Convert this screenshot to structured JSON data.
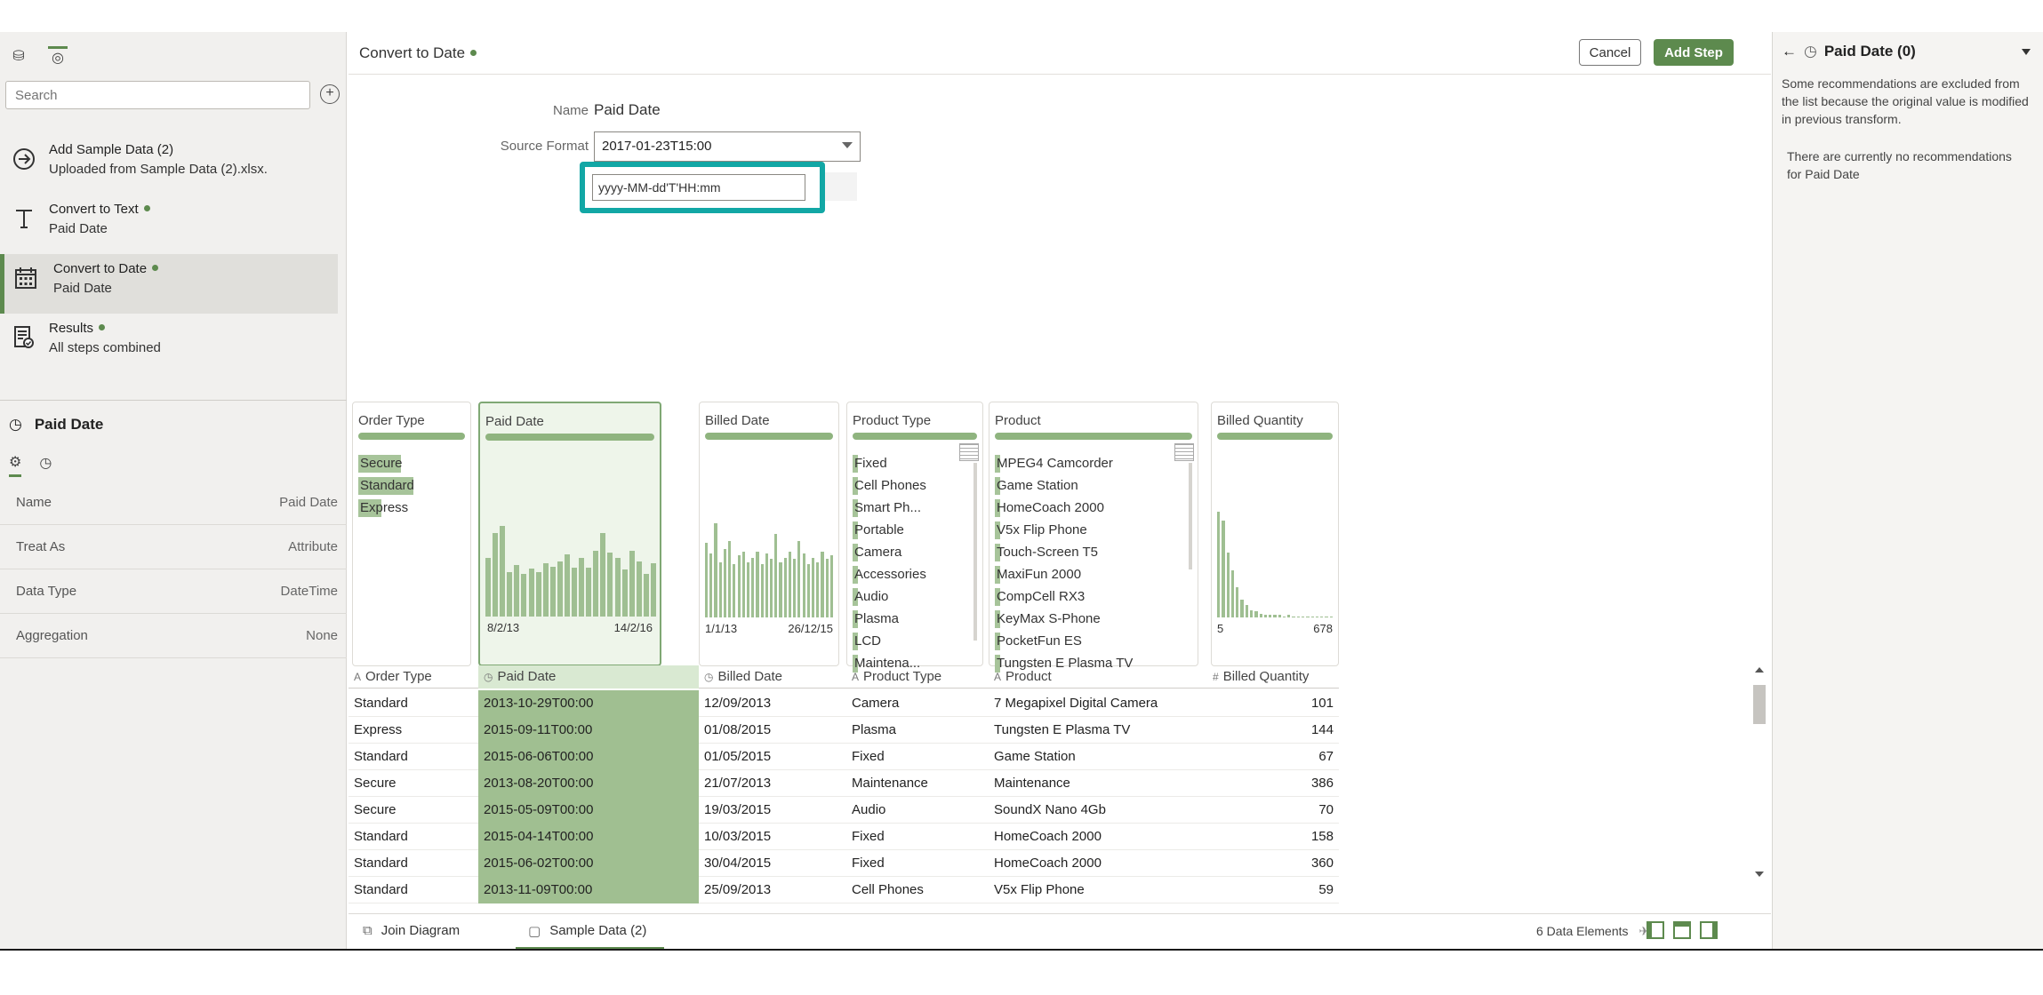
{
  "left": {
    "search_placeholder": "Search",
    "steps": [
      {
        "title": "Add Sample Data (2)",
        "subtitle": "Uploaded from Sample Data (2).xlsx.",
        "icon": "arrow-circle-icon"
      },
      {
        "title": "Convert to Text",
        "subtitle": "Paid Date",
        "icon": "text-t-icon"
      },
      {
        "title": "Convert to Date",
        "subtitle": "Paid Date",
        "icon": "calendar-icon"
      },
      {
        "title": "Results",
        "subtitle": "All steps combined",
        "icon": "results-icon"
      }
    ],
    "props": {
      "title": "Paid Date",
      "rows": [
        {
          "label": "Name",
          "value": "Paid Date"
        },
        {
          "label": "Treat As",
          "value": "Attribute"
        },
        {
          "label": "Data Type",
          "value": "DateTime"
        },
        {
          "label": "Aggregation",
          "value": "None"
        }
      ]
    }
  },
  "center": {
    "title": "Convert to Date",
    "cancel_label": "Cancel",
    "add_step_label": "Add Step",
    "name_label": "Name",
    "name_value": "Paid Date",
    "source_format_label": "Source Format",
    "source_format_value": "2017-01-23T15:00",
    "format_input_value": "yyyy-MM-dd'T'HH:mm"
  },
  "cards": {
    "order_type": {
      "title": "Order Type",
      "items": [
        {
          "label": "Secure",
          "fill": 0.39
        },
        {
          "label": "Standard",
          "fill": 0.51
        },
        {
          "label": "Express",
          "fill": 0.21
        }
      ]
    },
    "paid_date": {
      "title": "Paid Date",
      "axis_min": "8/2/13",
      "axis_max": "14/2/16",
      "bars": [
        0.55,
        0.78,
        0.85,
        0.42,
        0.48,
        0.4,
        0.45,
        0.42,
        0.5,
        0.47,
        0.52,
        0.58,
        0.46,
        0.55,
        0.46,
        0.62,
        0.78,
        0.6,
        0.55,
        0.44,
        0.62,
        0.52,
        0.4,
        0.5
      ]
    },
    "billed_date": {
      "title": "Billed Date",
      "axis_min": "1/1/13",
      "axis_max": "26/12/15",
      "bars": [
        0.7,
        0.6,
        0.88,
        0.52,
        0.64,
        0.72,
        0.5,
        0.58,
        0.62,
        0.52,
        0.56,
        0.62,
        0.5,
        0.6,
        0.55,
        0.78,
        0.52,
        0.56,
        0.62,
        0.55,
        0.72,
        0.6,
        0.5,
        0.56,
        0.52,
        0.62,
        0.55,
        0.58
      ]
    },
    "product_type": {
      "title": "Product Type",
      "items": [
        {
          "label": "Fixed",
          "fill": 0.05
        },
        {
          "label": "Cell Phones",
          "fill": 0.05
        },
        {
          "label": "Smart Ph...",
          "fill": 0.05
        },
        {
          "label": "Portable",
          "fill": 0.05
        },
        {
          "label": "Camera",
          "fill": 0.05
        },
        {
          "label": "Accessories",
          "fill": 0.05
        },
        {
          "label": "Audio",
          "fill": 0.05
        },
        {
          "label": "Plasma",
          "fill": 0.05
        },
        {
          "label": "LCD",
          "fill": 0.05
        },
        {
          "label": "Maintena...",
          "fill": 0.05
        }
      ]
    },
    "product": {
      "title": "Product",
      "items": [
        {
          "label": "MPEG4 Camcorder",
          "fill": 0.03
        },
        {
          "label": "Game Station",
          "fill": 0.03
        },
        {
          "label": "HomeCoach 2000",
          "fill": 0.03
        },
        {
          "label": "V5x Flip Phone",
          "fill": 0.03
        },
        {
          "label": "Touch-Screen T5",
          "fill": 0.03
        },
        {
          "label": "MaxiFun 2000",
          "fill": 0.03
        },
        {
          "label": "CompCell RX3",
          "fill": 0.03
        },
        {
          "label": "KeyMax S-Phone",
          "fill": 0.03
        },
        {
          "label": "PocketFun ES",
          "fill": 0.03
        },
        {
          "label": "Tungsten E Plasma TV",
          "fill": 0.03
        }
      ]
    },
    "billed_quantity": {
      "title": "Billed Quantity",
      "axis_min": "5",
      "axis_max": "678",
      "bars": [
        0.85,
        0.78,
        0.52,
        0.38,
        0.24,
        0.14,
        0.1,
        0.06,
        0.05,
        0.03,
        0.02,
        0.02,
        0.02,
        0.02,
        0.01,
        0.02,
        0.01,
        0.01,
        0.01,
        0.01,
        0.01,
        0.01,
        0.01,
        0.01,
        0.01
      ]
    }
  },
  "grid": {
    "columns": [
      {
        "name": "Order Type",
        "type": "A"
      },
      {
        "name": "Paid Date",
        "type": "◷"
      },
      {
        "name": "Billed Date",
        "type": "◷"
      },
      {
        "name": "Product Type",
        "type": "A"
      },
      {
        "name": "Product",
        "type": "A"
      },
      {
        "name": "Billed Quantity",
        "type": "#"
      }
    ],
    "rows": [
      [
        "Standard",
        "2013-10-29T00:00",
        "12/09/2013",
        "Camera",
        "7 Megapixel Digital Camera",
        "101"
      ],
      [
        "Express",
        "2015-09-11T00:00",
        "01/08/2015",
        "Plasma",
        "Tungsten E Plasma TV",
        "144"
      ],
      [
        "Standard",
        "2015-06-06T00:00",
        "01/05/2015",
        "Fixed",
        "Game Station",
        "67"
      ],
      [
        "Secure",
        "2013-08-20T00:00",
        "21/07/2013",
        "Maintenance",
        "Maintenance",
        "386"
      ],
      [
        "Secure",
        "2015-05-09T00:00",
        "19/03/2015",
        "Audio",
        "SoundX Nano 4Gb",
        "70"
      ],
      [
        "Standard",
        "2015-04-14T00:00",
        "10/03/2015",
        "Fixed",
        "HomeCoach 2000",
        "158"
      ],
      [
        "Standard",
        "2015-06-02T00:00",
        "30/04/2015",
        "Fixed",
        "HomeCoach 2000",
        "360"
      ],
      [
        "Standard",
        "2013-11-09T00:00",
        "25/09/2013",
        "Cell Phones",
        "V5x Flip Phone",
        "59"
      ]
    ]
  },
  "bottom": {
    "join_diagram": "Join Diagram",
    "sample_data": "Sample Data (2)",
    "status": "6 Data Elements"
  },
  "right": {
    "title": "Paid Date (0)",
    "note": "Some recommendations are excluded from the list because the original value is modified in previous transform.",
    "none": "There are currently no recommendations for Paid Date"
  },
  "colors": {
    "accent": "#5d8a4e",
    "highlight": "#12a7a5",
    "bar": "#9fbf92"
  }
}
